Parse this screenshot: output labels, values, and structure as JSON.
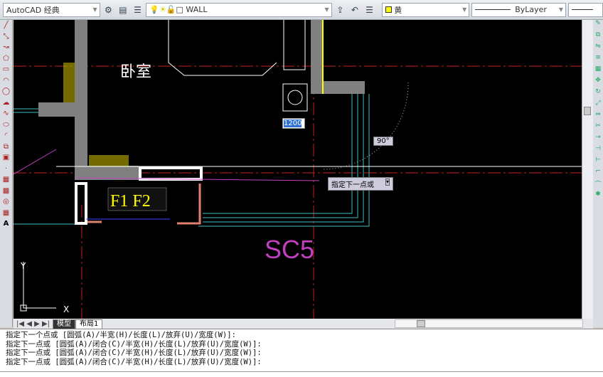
{
  "toolbar": {
    "workspace": "AutoCAD 经典",
    "layer": "WALL",
    "color": "黄",
    "linetype": "ByLayer",
    "lineweight": "ByLayer"
  },
  "drawing": {
    "room_label": "卧室",
    "tag": "F1 F2",
    "sc_label": "SC5",
    "dim_input": "1200",
    "angle": "90°",
    "prompt": "指定下一点或",
    "ucs_x": "X",
    "ucs_y": "Y"
  },
  "tabs": [
    "模型",
    "布局1"
  ],
  "command_history": [
    "指定下一个点或 [圆弧(A)/半宽(H)/长度(L)/放弃(U)/宽度(W)]:",
    "指定下一点或 [圆弧(A)/闭合(C)/半宽(H)/长度(L)/放弃(U)/宽度(W)]:",
    "指定下一点或 [圆弧(A)/闭合(C)/半宽(H)/长度(L)/放弃(U)/宽度(W)]:",
    "指定下一点或 [圆弧(A)/闭合(C)/半宽(H)/长度(L)/放弃(U)/宽度(W)]:"
  ],
  "colors": {
    "wall": "#808080",
    "yellow": "#ffff00",
    "magenta": "#c040c0",
    "cyan": "#40c0c0",
    "red": "#c02020"
  }
}
